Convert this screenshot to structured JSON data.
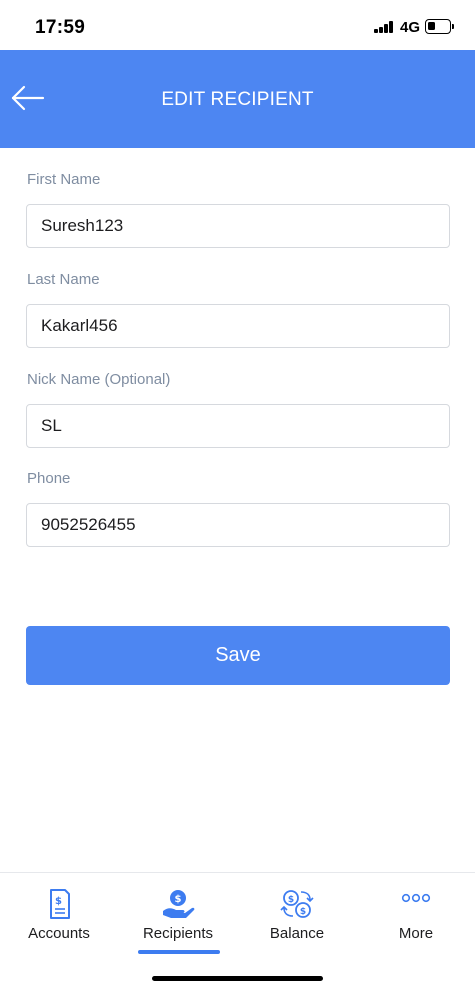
{
  "status_bar": {
    "time": "17:59",
    "network": "4G"
  },
  "header": {
    "title": "EDIT RECIPIENT",
    "back_icon": "arrow-left-icon"
  },
  "form": {
    "first_name": {
      "label": "First Name",
      "value": "Suresh123"
    },
    "last_name": {
      "label": "Last Name",
      "value": "Kakarl456"
    },
    "nick_name": {
      "label": "Nick Name (Optional)",
      "value": "SL"
    },
    "phone": {
      "label": "Phone",
      "value": "9052526455"
    }
  },
  "save_label": "Save",
  "tabs": [
    {
      "label": "Accounts",
      "icon": "document-dollar-icon",
      "active": false
    },
    {
      "label": "Recipients",
      "icon": "hand-coin-icon",
      "active": true
    },
    {
      "label": "Balance",
      "icon": "currency-exchange-icon",
      "active": false
    },
    {
      "label": "More",
      "icon": "more-dots-icon",
      "active": false
    }
  ],
  "colors": {
    "primary": "#4d86f2",
    "label": "#7f8da1",
    "icon": "#3d7cf0"
  }
}
